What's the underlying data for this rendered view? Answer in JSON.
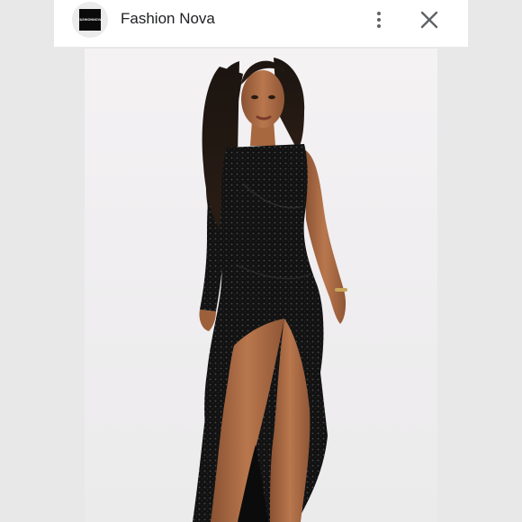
{
  "header": {
    "site_name": "Fashion Nova",
    "logo_text": "FASHIONNOVA",
    "avatar_icon": "fashion-nova-logo-icon",
    "menu_icon": "more-vertical-icon",
    "close_icon": "close-icon"
  },
  "photo": {
    "subject": "product-photo"
  },
  "colors": {
    "header_bg": "#ffffff",
    "page_bg": "#e8e8e9",
    "icon_gray": "#5f6368",
    "dress": "#111111"
  }
}
